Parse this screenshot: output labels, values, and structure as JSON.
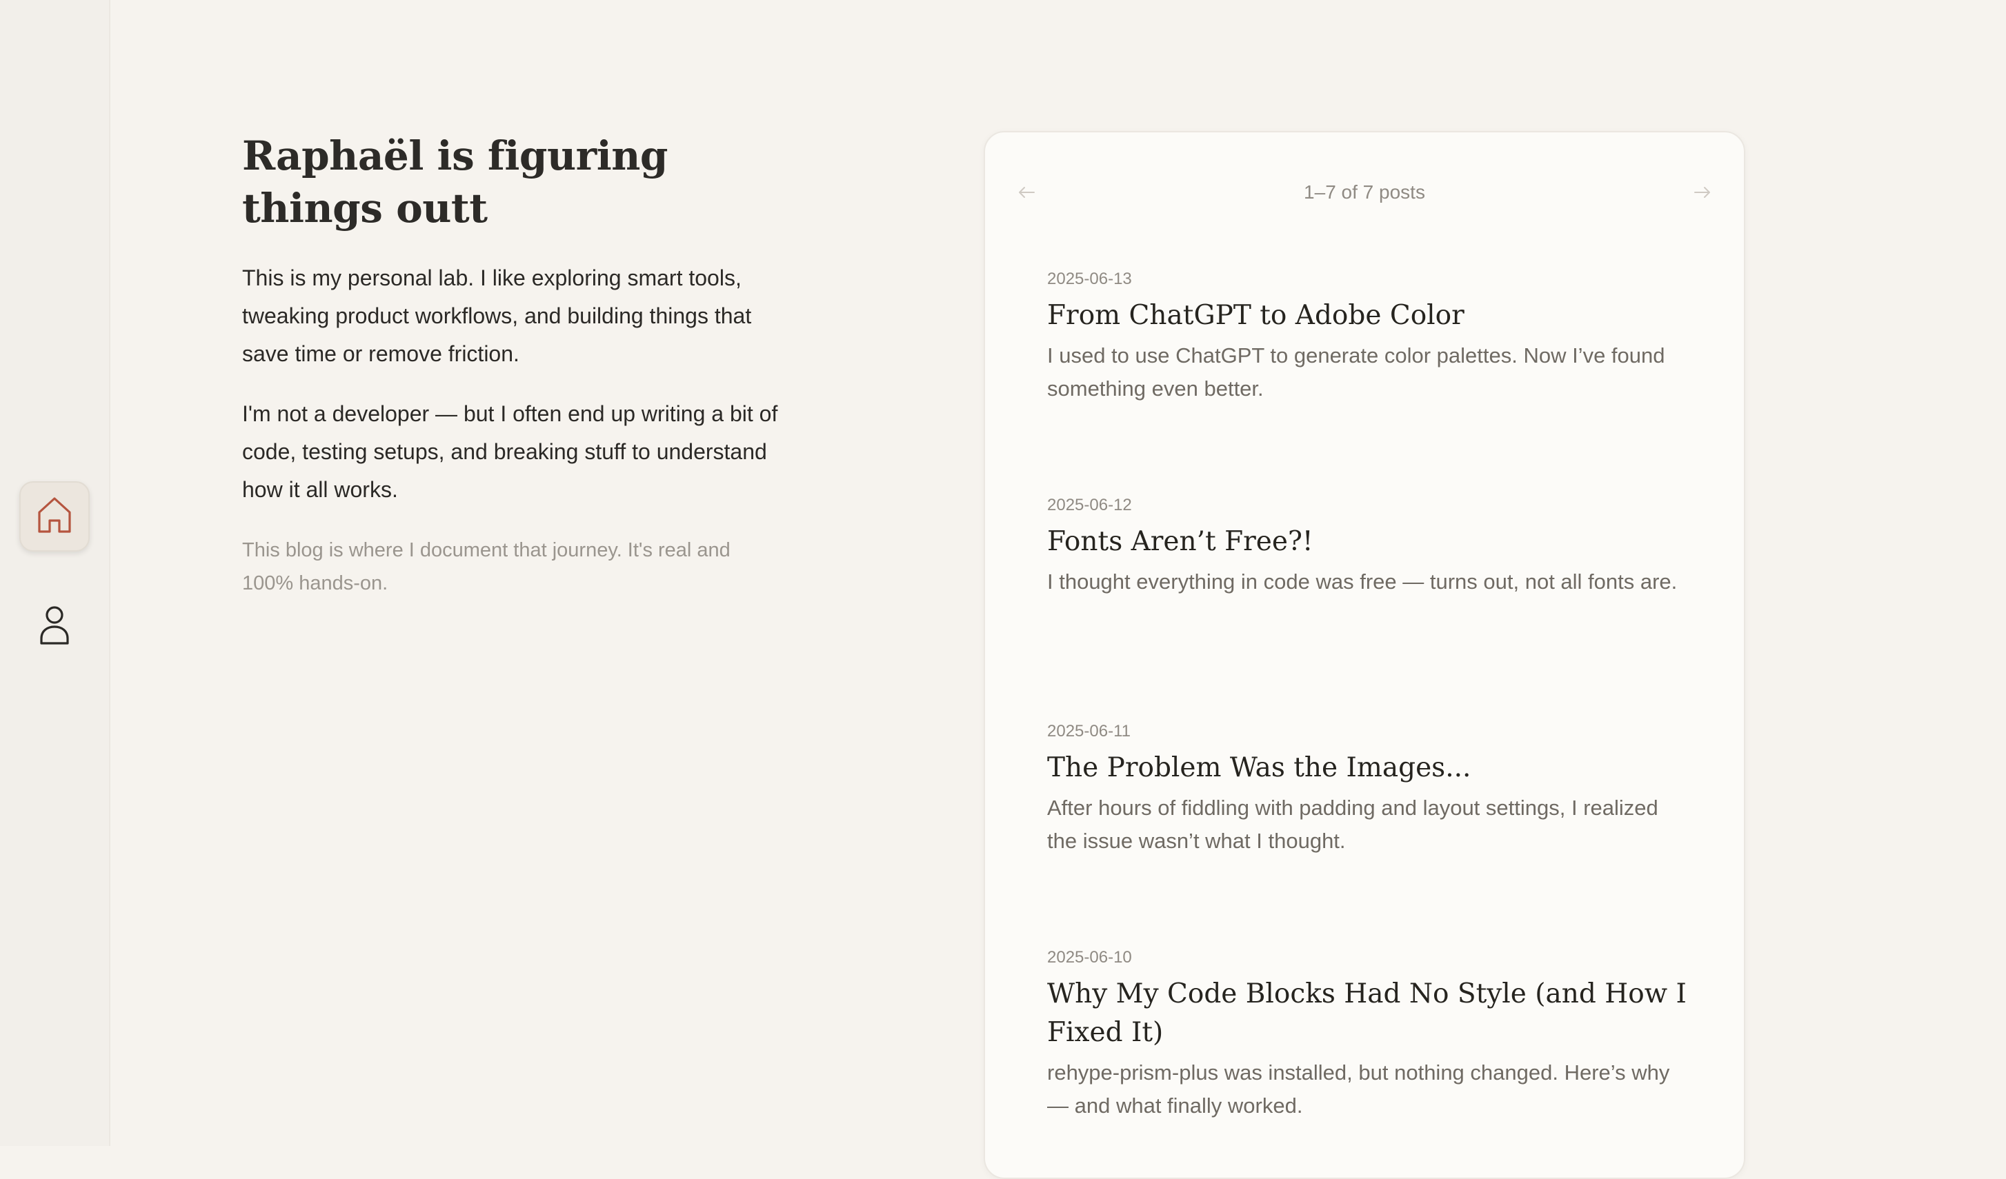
{
  "sidebar": {
    "items": [
      {
        "name": "home",
        "icon": "home-icon",
        "active": true,
        "accent": "#b5553f"
      },
      {
        "name": "profile",
        "icon": "user-icon",
        "active": false
      }
    ]
  },
  "intro": {
    "title": "Raphaël is figuring things outt",
    "paragraph1": "This is my personal lab. I like exploring smart tools, tweaking product workflows, and building things that save time or remove friction.",
    "paragraph2": "I'm not a developer — but I often end up writing a bit of code, testing setups, and breaking stuff to understand how it all works.",
    "note": "This blog is where I document that journey. It's real and 100% hands-on."
  },
  "pager": {
    "count": "1–7 of 7 posts",
    "prev_icon": "arrow-left-icon",
    "next_icon": "arrow-right-icon"
  },
  "posts": [
    {
      "date": "2025-06-13",
      "title": "From ChatGPT to Adobe Color",
      "excerpt": "I used to use ChatGPT to generate color palettes. Now I’ve found something even better."
    },
    {
      "date": "2025-06-12",
      "title": "Fonts Aren’t Free?!",
      "excerpt": "I thought everything in code was free — turns out, not all fonts are."
    },
    {
      "date": "2025-06-11",
      "title": "The Problem Was the Images...",
      "excerpt": "After hours of fiddling with padding and layout settings, I realized the issue wasn’t what I thought."
    },
    {
      "date": "2025-06-10",
      "title": "Why My Code Blocks Had No Style (and How I Fixed It)",
      "excerpt": "rehype-prism-plus was installed, but nothing changed. Here’s why — and what finally worked."
    }
  ]
}
